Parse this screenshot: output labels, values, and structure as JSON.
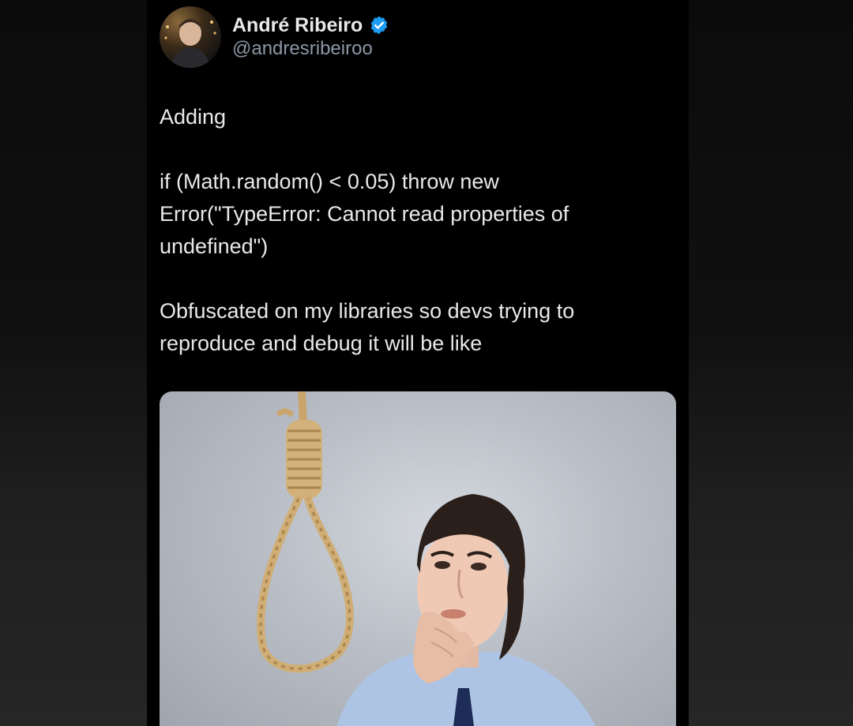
{
  "tweet": {
    "author": {
      "name": "André Ribeiro",
      "handle": "@andresribeiroo",
      "verified": true,
      "verified_color": "#1d9bf0"
    },
    "text": {
      "line1": "Adding",
      "code": "if (Math.random() < 0.05) throw new Error(\"TypeError: Cannot read properties of undefined\")",
      "line3": "Obfuscated on my libraries so devs trying to reproduce and debug it will be like"
    },
    "media": {
      "description_icon": "noose-and-thinking-man-photo"
    }
  },
  "colors": {
    "card_background": "#000000",
    "text_primary": "#e7e9ea",
    "text_secondary": "#8b98a5"
  }
}
